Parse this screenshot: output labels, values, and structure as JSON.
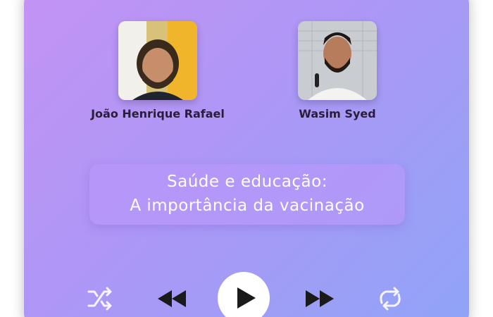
{
  "speakers": [
    {
      "name": "João Henrique Rafael",
      "photo": "portrait-photo"
    },
    {
      "name": "Wasim Syed",
      "photo": "portrait-photo"
    }
  ],
  "episode": {
    "title_line1": "Saúde e educação:",
    "title_line2": "A importância da vacinação"
  },
  "controls": {
    "shuffle": "shuffle-icon",
    "rewind": "rewind-icon",
    "play": "play-icon",
    "forward": "fast-forward-icon",
    "repeat": "repeat-icon"
  },
  "colors": {
    "gradient_start": "#c393f4",
    "gradient_end": "#8fa4f7",
    "name_text": "#2a1d3a",
    "title_text": "#ffffff"
  }
}
